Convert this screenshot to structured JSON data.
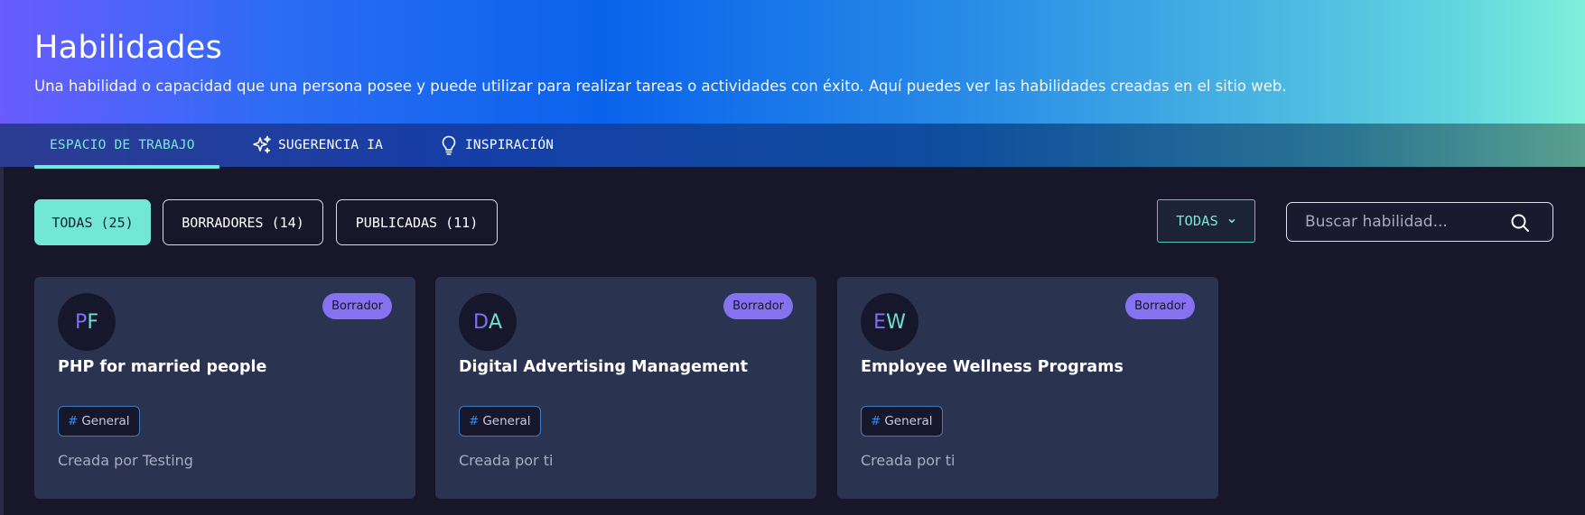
{
  "header": {
    "title": "Habilidades",
    "subtitle": "Una habilidad o capacidad que una persona posee y puede utilizar para realizar tareas o actividades con éxito. Aquí puedes ver las habilidades creadas en el sitio web."
  },
  "tabs": [
    {
      "label": "ESPACIO DE TRABAJO",
      "icon": null,
      "active": true
    },
    {
      "label": "SUGERENCIA IA",
      "icon": "sparkle-icon",
      "active": false
    },
    {
      "label": "INSPIRACIÓN",
      "icon": "lightbulb-icon",
      "active": false
    }
  ],
  "filters": [
    {
      "label": "TODAS (25)",
      "active": true
    },
    {
      "label": "BORRADORES (14)",
      "active": false
    },
    {
      "label": "PUBLICADAS (11)",
      "active": false
    }
  ],
  "dropdown": {
    "selected": "TODAS",
    "icon": "chevron-down-icon"
  },
  "search": {
    "placeholder": "Buscar habilidad...",
    "value": "",
    "icon": "search-icon"
  },
  "cards": [
    {
      "initials_a": "P",
      "initials_b": "F",
      "badge": "Borrador",
      "title": "PHP for married people",
      "tag": "General",
      "creator": "Creada por Testing"
    },
    {
      "initials_a": "D",
      "initials_b": "A",
      "badge": "Borrador",
      "title": "Digital Advertising Management",
      "tag": "General",
      "creator": "Creada por ti"
    },
    {
      "initials_a": "E",
      "initials_b": "W",
      "badge": "Borrador",
      "title": "Employee Wellness Programs",
      "tag": "General",
      "creator": "Creada por ti"
    }
  ],
  "tag_hash": "#",
  "colors": {
    "accent_teal": "#72e8d4",
    "badge_purple": "#8671f0",
    "card_bg": "#2a3350",
    "page_bg": "#18172a"
  }
}
